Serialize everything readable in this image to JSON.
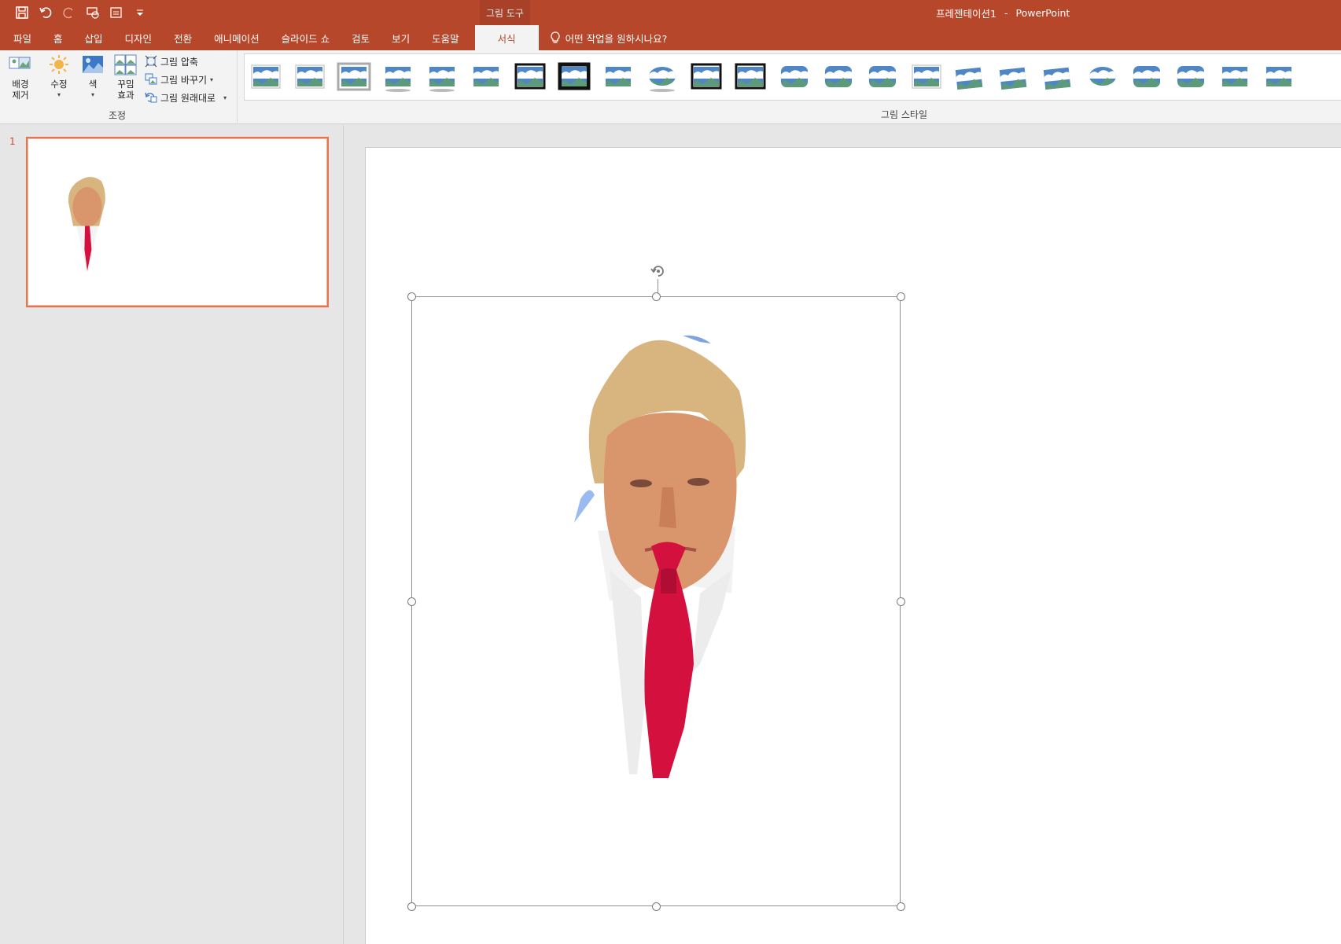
{
  "quick_access": {
    "icons": [
      "save-icon",
      "undo-icon",
      "redo-icon",
      "from-beginning-icon",
      "layout-icon",
      "customize-icon"
    ]
  },
  "context": {
    "label": "그림 도구"
  },
  "doc": {
    "name": "프레젠테이션1",
    "separator": "-",
    "app": "PowerPoint"
  },
  "tabs": [
    {
      "label": "파일"
    },
    {
      "label": "홈"
    },
    {
      "label": "삽입"
    },
    {
      "label": "디자인"
    },
    {
      "label": "전환"
    },
    {
      "label": "애니메이션"
    },
    {
      "label": "슬라이드 쇼"
    },
    {
      "label": "검토"
    },
    {
      "label": "보기"
    },
    {
      "label": "도움말"
    },
    {
      "label": "서식"
    }
  ],
  "tell_me": {
    "label": "어떤 작업을 원하시나요?"
  },
  "ribbon": {
    "adjust": {
      "remove_bg": {
        "line1": "배경",
        "line2": "제거"
      },
      "corrections": {
        "label": "수정"
      },
      "color": {
        "label": "색"
      },
      "artistic": {
        "line1": "꾸밈",
        "line2": "효과"
      },
      "compress": {
        "label": "그림 압축"
      },
      "change": {
        "label": "그림 바꾸기"
      },
      "reset": {
        "label": "그림 원래대로"
      },
      "group_label": "조정"
    },
    "styles": {
      "group_label": "그림 스타일",
      "count": 24
    }
  },
  "thumbnails": [
    {
      "number": "1"
    }
  ],
  "colors": {
    "accent": "#b7472a",
    "thumb_border": "#e8744f",
    "tie": "#d4103e",
    "skin": "#d9956b",
    "hair": "#d8b57f"
  }
}
